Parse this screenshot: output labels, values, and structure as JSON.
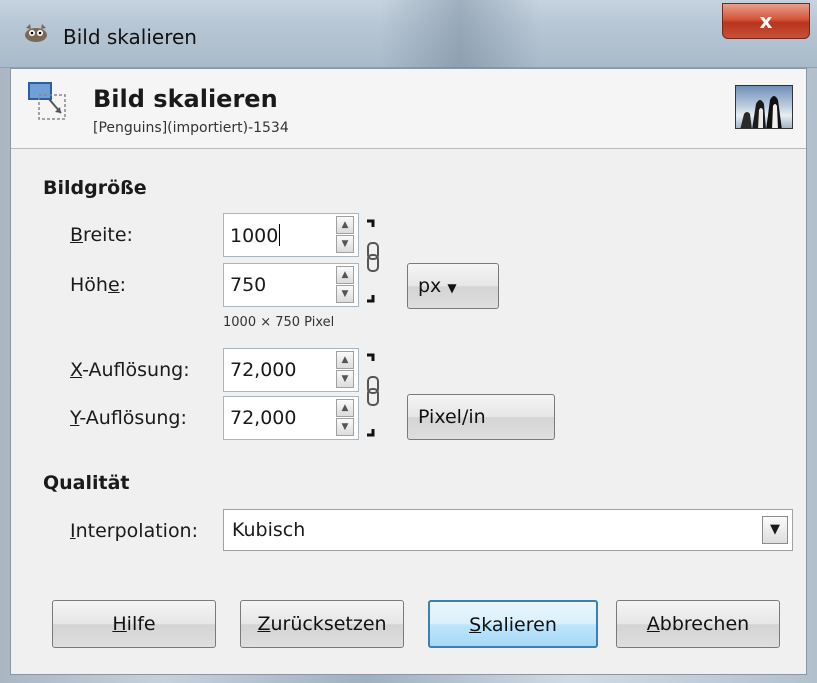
{
  "window": {
    "title": "Bild skalieren",
    "close_label": "x"
  },
  "header": {
    "title": "Bild skalieren",
    "subtitle": "[Penguins](importiert)-1534"
  },
  "image_size": {
    "section_label": "Bildgröße",
    "width": {
      "label_pre": "",
      "label_ul": "B",
      "label_post": "reite:",
      "value": "1000"
    },
    "height": {
      "label_pre": "Höh",
      "label_ul": "e",
      "label_post": ":",
      "value": "750"
    },
    "unit": "px",
    "size_info": "1000 × 750 Pixel",
    "x_res": {
      "label_pre": "",
      "label_ul": "X",
      "label_post": "-Auflösung:",
      "value": "72,000"
    },
    "y_res": {
      "label_pre": "",
      "label_ul": "Y",
      "label_post": "-Auflösung:",
      "value": "72,000"
    },
    "res_unit": "Pixel/in"
  },
  "quality": {
    "section_label": "Qualität",
    "interpolation": {
      "label_pre": "",
      "label_ul": "I",
      "label_post": "nterpolation:",
      "value": "Kubisch"
    }
  },
  "buttons": {
    "help": {
      "ul": "H",
      "rest": "ilfe"
    },
    "reset": {
      "ul": "Z",
      "rest": "urücksetzen"
    },
    "scale": {
      "ul": "S",
      "rest": "kalieren"
    },
    "cancel": {
      "ul": "A",
      "rest": "bbrechen"
    }
  },
  "icons": {
    "app": "gimp-wilber-icon",
    "header": "scale-image-icon",
    "thumbnail": "penguins-thumbnail",
    "chain": "chain-link-icon",
    "spin_up": "spin-up-icon",
    "spin_down": "spin-down-icon",
    "dropdown": "dropdown-arrow-icon"
  },
  "colors": {
    "close_red": "#c9503a",
    "focus_blue": "#3c7fb1",
    "client_bg": "#f0f0f0"
  }
}
